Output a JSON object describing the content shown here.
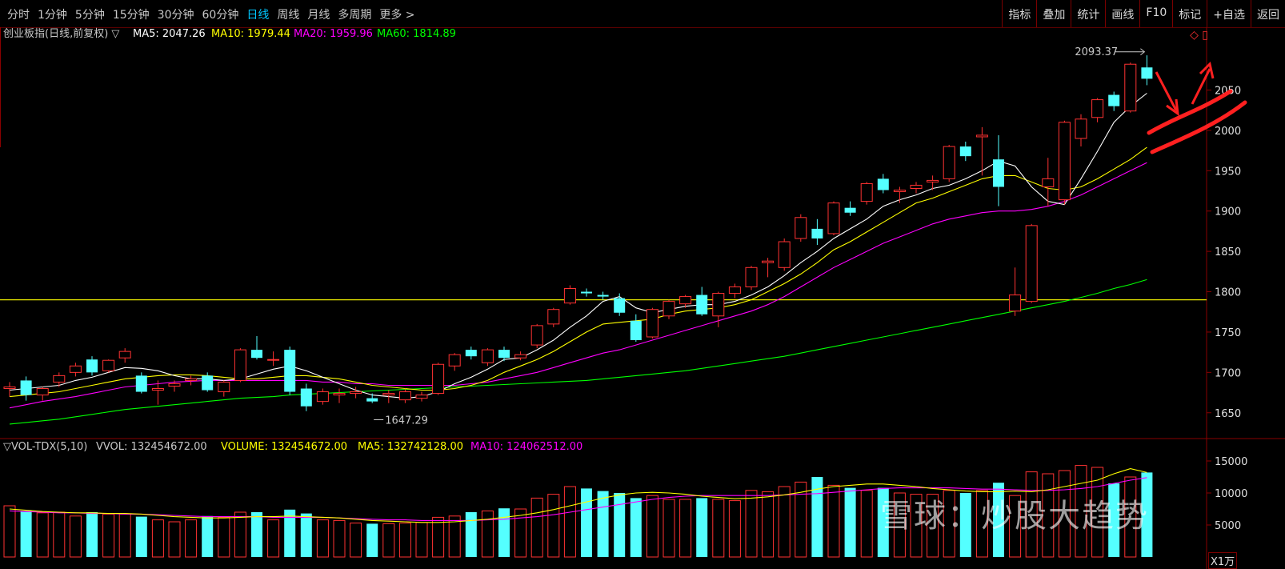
{
  "toolbar": {
    "periods": [
      "分时",
      "1分钟",
      "5分钟",
      "15分钟",
      "30分钟",
      "60分钟",
      "日线",
      "周线",
      "月线",
      "多周期",
      "更多 >"
    ],
    "active_period": "日线",
    "buttons": [
      "指标",
      "叠加",
      "统计",
      "画线",
      "F10",
      "标记",
      "+自选",
      "返回"
    ]
  },
  "legend": {
    "name": "创业板指(日线,前复权) ▽",
    "ma5": "MA5: 2047.26",
    "ma10": "MA10: 1979.44",
    "ma20": "MA20: 1959.96",
    "ma60": "MA60: 1814.89",
    "colors": {
      "ma5": "#ffffff",
      "ma10": "#ffff00",
      "ma20": "#ff00ff",
      "ma60": "#00ff00"
    }
  },
  "vol_legend": {
    "name": "▽VOL-TDX(5,10)",
    "vvol": "VVOL: 132454672.00",
    "volume": "VOLUME: 132454672.00",
    "ma5": "MA5: 132742128.00",
    "ma10": "MA10: 124062512.00"
  },
  "annotations": {
    "high_label": "2093.37",
    "low_label": "1647.29"
  },
  "watermark": "雪球：炒股大趋势",
  "unit_label": "X1万",
  "chart_data": {
    "type": "candlestick",
    "price_axis": {
      "ticks": [
        1650,
        1700,
        1750,
        1800,
        1850,
        1900,
        1950,
        2000,
        2050
      ],
      "range": [
        1620,
        2110
      ]
    },
    "volume_axis": {
      "ticks": [
        5000,
        10000,
        15000
      ],
      "unit": "X1万",
      "range": [
        0,
        16000
      ]
    },
    "horizontal_line": 1790,
    "candles": [
      {
        "o": 1680,
        "h": 1688,
        "l": 1670,
        "c": 1682,
        "v": 8000
      },
      {
        "o": 1690,
        "h": 1695,
        "l": 1665,
        "c": 1672,
        "v": 7200
      },
      {
        "o": 1672,
        "h": 1682,
        "l": 1665,
        "c": 1680,
        "v": 6900
      },
      {
        "o": 1688,
        "h": 1700,
        "l": 1682,
        "c": 1696,
        "v": 7000
      },
      {
        "o": 1700,
        "h": 1712,
        "l": 1695,
        "c": 1708,
        "v": 6400
      },
      {
        "o": 1716,
        "h": 1720,
        "l": 1696,
        "c": 1700,
        "v": 7000
      },
      {
        "o": 1702,
        "h": 1716,
        "l": 1700,
        "c": 1715,
        "v": 6700
      },
      {
        "o": 1718,
        "h": 1730,
        "l": 1712,
        "c": 1726,
        "v": 6700
      },
      {
        "o": 1696,
        "h": 1700,
        "l": 1674,
        "c": 1676,
        "v": 6300
      },
      {
        "o": 1678,
        "h": 1690,
        "l": 1660,
        "c": 1680,
        "v": 5800
      },
      {
        "o": 1683,
        "h": 1690,
        "l": 1676,
        "c": 1686,
        "v": 5500
      },
      {
        "o": 1690,
        "h": 1696,
        "l": 1684,
        "c": 1692,
        "v": 5800
      },
      {
        "o": 1696,
        "h": 1700,
        "l": 1676,
        "c": 1678,
        "v": 6400
      },
      {
        "o": 1676,
        "h": 1690,
        "l": 1670,
        "c": 1688,
        "v": 6200
      },
      {
        "o": 1690,
        "h": 1730,
        "l": 1688,
        "c": 1728,
        "v": 7000
      },
      {
        "o": 1728,
        "h": 1745,
        "l": 1716,
        "c": 1718,
        "v": 7000
      },
      {
        "o": 1716,
        "h": 1726,
        "l": 1708,
        "c": 1716,
        "v": 5800
      },
      {
        "o": 1728,
        "h": 1732,
        "l": 1672,
        "c": 1676,
        "v": 7400
      },
      {
        "o": 1680,
        "h": 1686,
        "l": 1652,
        "c": 1658,
        "v": 6800
      },
      {
        "o": 1664,
        "h": 1680,
        "l": 1660,
        "c": 1676,
        "v": 5800
      },
      {
        "o": 1672,
        "h": 1680,
        "l": 1662,
        "c": 1674,
        "v": 5700
      },
      {
        "o": 1674,
        "h": 1682,
        "l": 1668,
        "c": 1676,
        "v": 5300
      },
      {
        "o": 1668,
        "h": 1674,
        "l": 1662,
        "c": 1664,
        "v": 5200
      },
      {
        "o": 1672,
        "h": 1678,
        "l": 1662,
        "c": 1674,
        "v": 5200
      },
      {
        "o": 1666,
        "h": 1680,
        "l": 1662,
        "c": 1676,
        "v": 5300
      },
      {
        "o": 1668,
        "h": 1676,
        "l": 1664,
        "c": 1672,
        "v": 5400
      },
      {
        "o": 1674,
        "h": 1712,
        "l": 1672,
        "c": 1710,
        "v": 6200
      },
      {
        "o": 1708,
        "h": 1724,
        "l": 1702,
        "c": 1722,
        "v": 6400
      },
      {
        "o": 1728,
        "h": 1732,
        "l": 1716,
        "c": 1720,
        "v": 7000
      },
      {
        "o": 1712,
        "h": 1730,
        "l": 1708,
        "c": 1728,
        "v": 7200
      },
      {
        "o": 1728,
        "h": 1732,
        "l": 1714,
        "c": 1718,
        "v": 7600
      },
      {
        "o": 1718,
        "h": 1726,
        "l": 1715,
        "c": 1722,
        "v": 7500
      },
      {
        "o": 1734,
        "h": 1760,
        "l": 1730,
        "c": 1758,
        "v": 9200
      },
      {
        "o": 1760,
        "h": 1780,
        "l": 1756,
        "c": 1778,
        "v": 9800
      },
      {
        "o": 1786,
        "h": 1808,
        "l": 1784,
        "c": 1804,
        "v": 11000
      },
      {
        "o": 1800,
        "h": 1804,
        "l": 1794,
        "c": 1798,
        "v": 10700
      },
      {
        "o": 1796,
        "h": 1800,
        "l": 1790,
        "c": 1794,
        "v": 10300
      },
      {
        "o": 1792,
        "h": 1798,
        "l": 1770,
        "c": 1774,
        "v": 10000
      },
      {
        "o": 1764,
        "h": 1772,
        "l": 1738,
        "c": 1740,
        "v": 9200
      },
      {
        "o": 1744,
        "h": 1780,
        "l": 1742,
        "c": 1778,
        "v": 9600
      },
      {
        "o": 1770,
        "h": 1790,
        "l": 1766,
        "c": 1788,
        "v": 9000
      },
      {
        "o": 1785,
        "h": 1796,
        "l": 1780,
        "c": 1794,
        "v": 9000
      },
      {
        "o": 1796,
        "h": 1806,
        "l": 1770,
        "c": 1772,
        "v": 9200
      },
      {
        "o": 1770,
        "h": 1800,
        "l": 1756,
        "c": 1798,
        "v": 9000
      },
      {
        "o": 1798,
        "h": 1810,
        "l": 1792,
        "c": 1806,
        "v": 8800
      },
      {
        "o": 1806,
        "h": 1832,
        "l": 1802,
        "c": 1830,
        "v": 10400
      },
      {
        "o": 1836,
        "h": 1842,
        "l": 1818,
        "c": 1838,
        "v": 10200
      },
      {
        "o": 1830,
        "h": 1866,
        "l": 1826,
        "c": 1862,
        "v": 11000
      },
      {
        "o": 1866,
        "h": 1896,
        "l": 1862,
        "c": 1892,
        "v": 11700
      },
      {
        "o": 1878,
        "h": 1890,
        "l": 1858,
        "c": 1866,
        "v": 12500
      },
      {
        "o": 1872,
        "h": 1912,
        "l": 1870,
        "c": 1910,
        "v": 11200
      },
      {
        "o": 1904,
        "h": 1912,
        "l": 1894,
        "c": 1898,
        "v": 10800
      },
      {
        "o": 1912,
        "h": 1936,
        "l": 1908,
        "c": 1934,
        "v": 10400
      },
      {
        "o": 1940,
        "h": 1946,
        "l": 1922,
        "c": 1926,
        "v": 10800
      },
      {
        "o": 1924,
        "h": 1930,
        "l": 1910,
        "c": 1926,
        "v": 10000
      },
      {
        "o": 1928,
        "h": 1936,
        "l": 1922,
        "c": 1932,
        "v": 9800
      },
      {
        "o": 1936,
        "h": 1944,
        "l": 1926,
        "c": 1938,
        "v": 9800
      },
      {
        "o": 1940,
        "h": 1982,
        "l": 1936,
        "c": 1980,
        "v": 10400
      },
      {
        "o": 1980,
        "h": 1986,
        "l": 1962,
        "c": 1968,
        "v": 10000
      },
      {
        "o": 1992,
        "h": 2004,
        "l": 1944,
        "c": 1994,
        "v": 10400
      },
      {
        "o": 1964,
        "h": 1994,
        "l": 1906,
        "c": 1930,
        "v": 11600
      },
      {
        "o": 1776,
        "h": 1830,
        "l": 1770,
        "c": 1796,
        "v": 9600
      },
      {
        "o": 1788,
        "h": 1884,
        "l": 1786,
        "c": 1882,
        "v": 13300
      },
      {
        "o": 1930,
        "h": 1966,
        "l": 1906,
        "c": 1940,
        "v": 13000
      },
      {
        "o": 1914,
        "h": 2012,
        "l": 1908,
        "c": 2010,
        "v": 13500
      },
      {
        "o": 1990,
        "h": 2020,
        "l": 1980,
        "c": 2014,
        "v": 14300
      },
      {
        "o": 2016,
        "h": 2040,
        "l": 2010,
        "c": 2038,
        "v": 14000
      },
      {
        "o": 2044,
        "h": 2048,
        "l": 2024,
        "c": 2030,
        "v": 11500
      },
      {
        "o": 2024,
        "h": 2084,
        "l": 2022,
        "c": 2082,
        "v": 12500
      },
      {
        "o": 2078,
        "h": 2093,
        "l": 2056,
        "c": 2064,
        "v": 13200
      }
    ],
    "ma5_line": [
      1678,
      1680,
      1682,
      1684,
      1690,
      1694,
      1700,
      1706,
      1705,
      1702,
      1696,
      1692,
      1692,
      1690,
      1692,
      1698,
      1704,
      1708,
      1702,
      1694,
      1686,
      1678,
      1672,
      1670,
      1668,
      1670,
      1676,
      1686,
      1694,
      1704,
      1716,
      1718,
      1728,
      1740,
      1756,
      1770,
      1788,
      1794,
      1780,
      1774,
      1778,
      1782,
      1784,
      1784,
      1788,
      1796,
      1806,
      1820,
      1836,
      1850,
      1866,
      1878,
      1890,
      1906,
      1914,
      1920,
      1928,
      1932,
      1940,
      1950,
      1962,
      1956,
      1930,
      1912,
      1908,
      1940,
      1974,
      2010,
      2030,
      2046
    ],
    "ma10_line": [
      1670,
      1672,
      1674,
      1676,
      1680,
      1684,
      1688,
      1692,
      1694,
      1696,
      1697,
      1697,
      1696,
      1694,
      1692,
      1692,
      1694,
      1696,
      1696,
      1694,
      1692,
      1688,
      1684,
      1682,
      1680,
      1678,
      1678,
      1680,
      1684,
      1690,
      1700,
      1708,
      1716,
      1726,
      1738,
      1750,
      1760,
      1762,
      1764,
      1766,
      1772,
      1776,
      1778,
      1780,
      1784,
      1790,
      1800,
      1810,
      1822,
      1836,
      1852,
      1862,
      1874,
      1886,
      1898,
      1910,
      1916,
      1924,
      1932,
      1940,
      1944,
      1944,
      1936,
      1928,
      1926,
      1930,
      1940,
      1952,
      1964,
      1979
    ],
    "ma20_line": [
      1656,
      1660,
      1664,
      1667,
      1670,
      1674,
      1678,
      1682,
      1684,
      1686,
      1688,
      1689,
      1690,
      1690,
      1690,
      1690,
      1690,
      1690,
      1690,
      1688,
      1688,
      1686,
      1686,
      1684,
      1684,
      1684,
      1684,
      1684,
      1686,
      1688,
      1692,
      1696,
      1700,
      1706,
      1712,
      1718,
      1724,
      1728,
      1734,
      1740,
      1746,
      1752,
      1758,
      1764,
      1770,
      1776,
      1784,
      1794,
      1806,
      1818,
      1830,
      1840,
      1850,
      1860,
      1868,
      1876,
      1884,
      1890,
      1894,
      1898,
      1900,
      1900,
      1902,
      1906,
      1912,
      1920,
      1930,
      1940,
      1950,
      1960
    ],
    "ma60_line": [
      1636,
      1638,
      1640,
      1642,
      1645,
      1648,
      1651,
      1654,
      1656,
      1658,
      1660,
      1662,
      1664,
      1666,
      1668,
      1669,
      1670,
      1672,
      1673,
      1674,
      1675,
      1676,
      1677,
      1678,
      1679,
      1680,
      1681,
      1682,
      1683,
      1684,
      1685,
      1686,
      1687,
      1688,
      1689,
      1690,
      1692,
      1694,
      1696,
      1698,
      1700,
      1702,
      1705,
      1708,
      1711,
      1714,
      1717,
      1720,
      1724,
      1728,
      1732,
      1736,
      1740,
      1744,
      1748,
      1752,
      1756,
      1760,
      1764,
      1768,
      1772,
      1776,
      1780,
      1784,
      1788,
      1793,
      1798,
      1804,
      1809,
      1815
    ],
    "vol_ma5_line": [
      7500,
      7300,
      7100,
      7000,
      6900,
      6900,
      6800,
      6800,
      6700,
      6500,
      6300,
      6200,
      6100,
      6100,
      6200,
      6300,
      6300,
      6400,
      6300,
      6200,
      6100,
      5900,
      5700,
      5600,
      5500,
      5400,
      5400,
      5500,
      5700,
      5900,
      6200,
      6500,
      6900,
      7400,
      8000,
      8600,
      9200,
      9700,
      10000,
      10100,
      10000,
      9800,
      9500,
      9300,
      9100,
      9200,
      9400,
      9700,
      10100,
      10600,
      11000,
      11200,
      11400,
      11400,
      11200,
      11000,
      10700,
      10500,
      10300,
      10200,
      10200,
      10300,
      10200,
      10500,
      11000,
      11500,
      12000,
      13000,
      13800,
      13200
    ],
    "vol_ma10_line": [
      7200,
      7100,
      7000,
      6900,
      6900,
      6800,
      6800,
      6700,
      6700,
      6600,
      6500,
      6400,
      6300,
      6300,
      6300,
      6300,
      6200,
      6200,
      6200,
      6200,
      6100,
      6000,
      5900,
      5800,
      5800,
      5700,
      5700,
      5700,
      5700,
      5800,
      5900,
      6100,
      6300,
      6600,
      7000,
      7400,
      7800,
      8200,
      8600,
      9000,
      9300,
      9500,
      9600,
      9600,
      9600,
      9600,
      9600,
      9700,
      9800,
      9900,
      10100,
      10300,
      10500,
      10700,
      10800,
      10800,
      10800,
      10800,
      10700,
      10600,
      10600,
      10500,
      10400,
      10400,
      10500,
      10700,
      11000,
      11500,
      12000,
      12400
    ]
  }
}
